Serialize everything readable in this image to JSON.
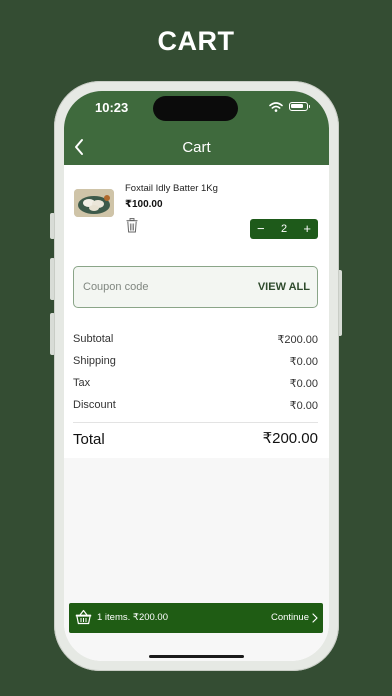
{
  "page": {
    "heading": "CART"
  },
  "status_bar": {
    "time": "10:23"
  },
  "header": {
    "title": "Cart"
  },
  "cart_items": [
    {
      "name": "Foxtail Idly Batter 1Kg",
      "price": "₹100.00",
      "quantity": "2"
    }
  ],
  "stepper": {
    "minus": "−",
    "plus": "+"
  },
  "coupon": {
    "placeholder": "Coupon code",
    "action": "VIEW ALL"
  },
  "summary": {
    "subtotal_label": "Subtotal",
    "subtotal_value": "₹200.00",
    "shipping_label": "Shipping",
    "shipping_value": "₹0.00",
    "tax_label": "Tax",
    "tax_value": "₹0.00",
    "discount_label": "Discount",
    "discount_value": "₹0.00",
    "total_label": "Total",
    "total_value": "₹200.00"
  },
  "bottom_bar": {
    "summary": "1 items. ₹200.00",
    "continue": "Continue"
  },
  "colors": {
    "background": "#344d33",
    "header": "#3f6a3d",
    "accent": "#1f5c14"
  }
}
